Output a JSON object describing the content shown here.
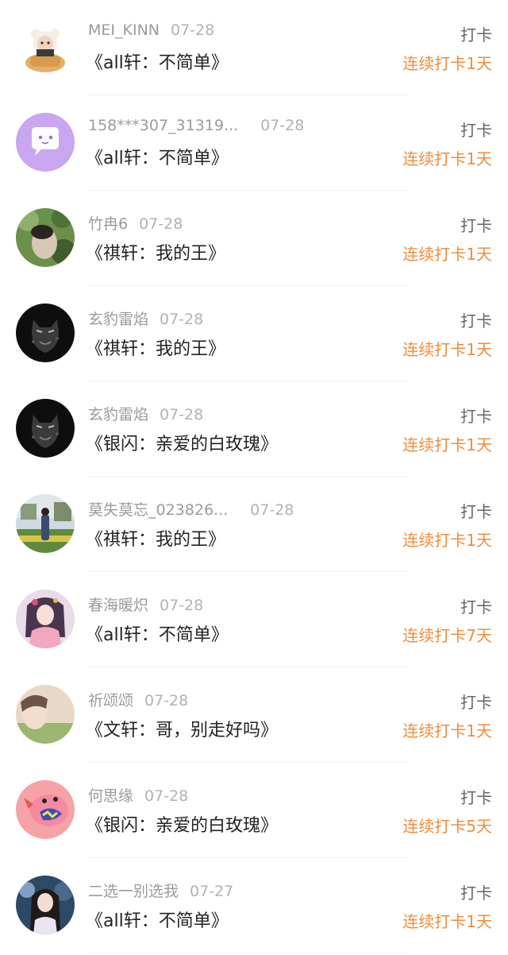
{
  "checkins": [
    {
      "user": "MEI_KINN",
      "date": "07-28",
      "book": "《all轩：不简单》",
      "action": "打卡",
      "streak": "连续打卡1天",
      "avatar": "bear-mascot-avatar"
    },
    {
      "user": "158***307_31319...",
      "date": "07-28",
      "book": "《all轩：不简单》",
      "action": "打卡",
      "streak": "连续打卡1天",
      "avatar": "purple-chat-bubble-avatar"
    },
    {
      "user": "竹冉6",
      "date": "07-28",
      "book": "《祺轩：我的王》",
      "action": "打卡",
      "streak": "连续打卡1天",
      "avatar": "green-leaves-photo-avatar"
    },
    {
      "user": "玄豹雷焰",
      "date": "07-28",
      "book": "《祺轩：我的王》",
      "action": "打卡",
      "streak": "连续打卡1天",
      "avatar": "black-panther-avatar"
    },
    {
      "user": "玄豹雷焰",
      "date": "07-28",
      "book": "《银闪：亲爱的白玫瑰》",
      "action": "打卡",
      "streak": "连续打卡1天",
      "avatar": "black-panther-avatar"
    },
    {
      "user": "莫失莫忘_023826...",
      "date": "07-28",
      "book": "《祺轩：我的王》",
      "action": "打卡",
      "streak": "连续打卡1天",
      "avatar": "outdoor-portrait-avatar"
    },
    {
      "user": "春海暖炽",
      "date": "07-28",
      "book": "《all轩：不简单》",
      "action": "打卡",
      "streak": "连续打卡7天",
      "avatar": "anime-girl-avatar"
    },
    {
      "user": "祈颂颂",
      "date": "07-28",
      "book": "《文轩：哥，别走好吗》",
      "action": "打卡",
      "streak": "连续打卡1天",
      "avatar": "soft-portrait-avatar"
    },
    {
      "user": "何思缘",
      "date": "07-28",
      "book": "《银闪：亲爱的白玫瑰》",
      "action": "打卡",
      "streak": "连续打卡5天",
      "avatar": "pink-cartoon-monster-avatar"
    },
    {
      "user": "二选一别选我",
      "date": "07-27",
      "book": "《all轩：不简单》",
      "action": "打卡",
      "streak": "连续打卡1天",
      "avatar": "girl-photo-avatar"
    }
  ],
  "colors": {
    "streak": "#f08c39",
    "action": "#666666",
    "meta": "#9b9b9b",
    "title": "#222222"
  }
}
